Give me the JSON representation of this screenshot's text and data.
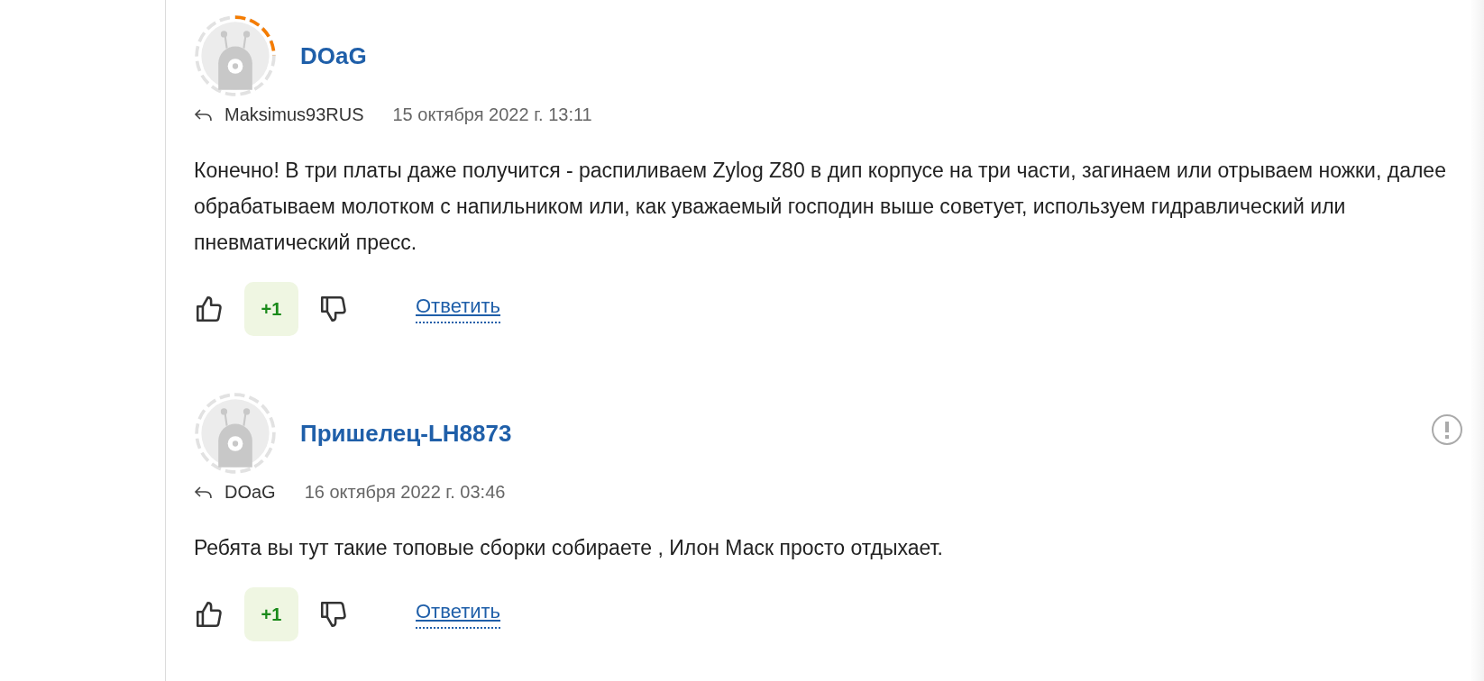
{
  "comments": [
    {
      "author": "DOaG",
      "avatar_ring_highlight": true,
      "reply_to": "Maksimus93RUS",
      "date": "15 октября 2022 г. 13:11",
      "report_visible": false,
      "text": "Конечно! В три платы даже получится - распиливаем Zylog Z80 в дип корпусе на три части, загинаем или отрываем ножки, далее обрабатываем молотком с напильником или, как уважаемый господин выше советует, используем гидравлический или пневматический пресс.",
      "score": "+1",
      "reply_label": "Ответить"
    },
    {
      "author": "Пришелец-LH8873",
      "avatar_ring_highlight": false,
      "reply_to": "DOaG",
      "date": "16 октября 2022 г. 03:46",
      "report_visible": true,
      "text": "Ребята вы тут такие топовые сборки собираете , Илон Маск просто отдыхает.",
      "score": "+1",
      "reply_label": "Ответить"
    }
  ]
}
